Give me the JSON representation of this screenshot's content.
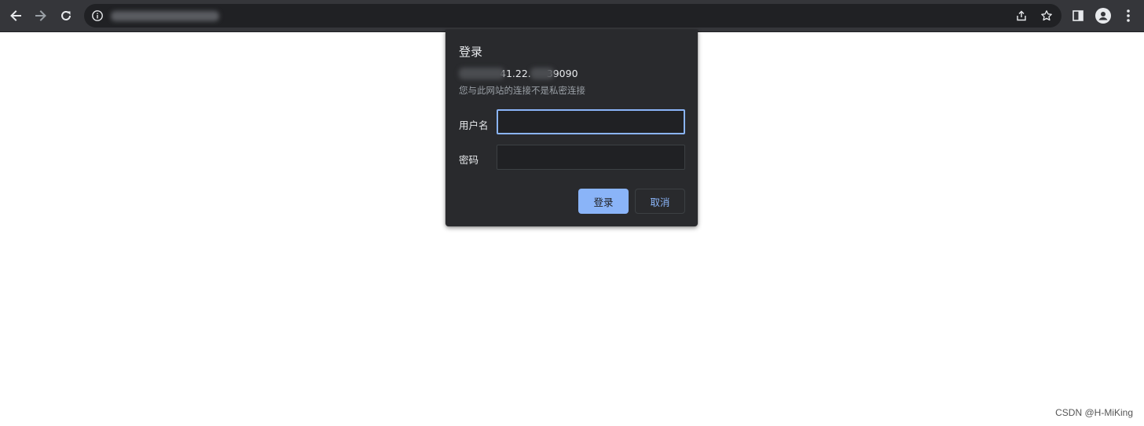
{
  "browser": {
    "back_icon": "arrow-left-icon",
    "forward_icon": "arrow-right-icon",
    "reload_icon": "reload-icon",
    "site_info_icon": "info-icon",
    "share_icon": "share-icon",
    "bookmark_icon": "star-icon",
    "side_panel_icon": "side-panel-icon",
    "profile_icon": "profile-avatar-icon",
    "menu_icon": "kebab-menu-icon",
    "colors": {
      "toolbar": "#35363a",
      "omnibox": "#202124"
    }
  },
  "dialog": {
    "title": "登录",
    "origin_partial_1": "41.22.",
    "origin_partial_2": "39090",
    "warning": "您与此网站的连接不是私密连接",
    "username_label": "用户名",
    "username_value": "",
    "password_label": "密码",
    "password_value": "",
    "login_button": "登录",
    "cancel_button": "取消",
    "colors": {
      "background": "#292a2d",
      "accent": "#8ab4f8"
    }
  },
  "watermark": "CSDN @H-MiKing"
}
